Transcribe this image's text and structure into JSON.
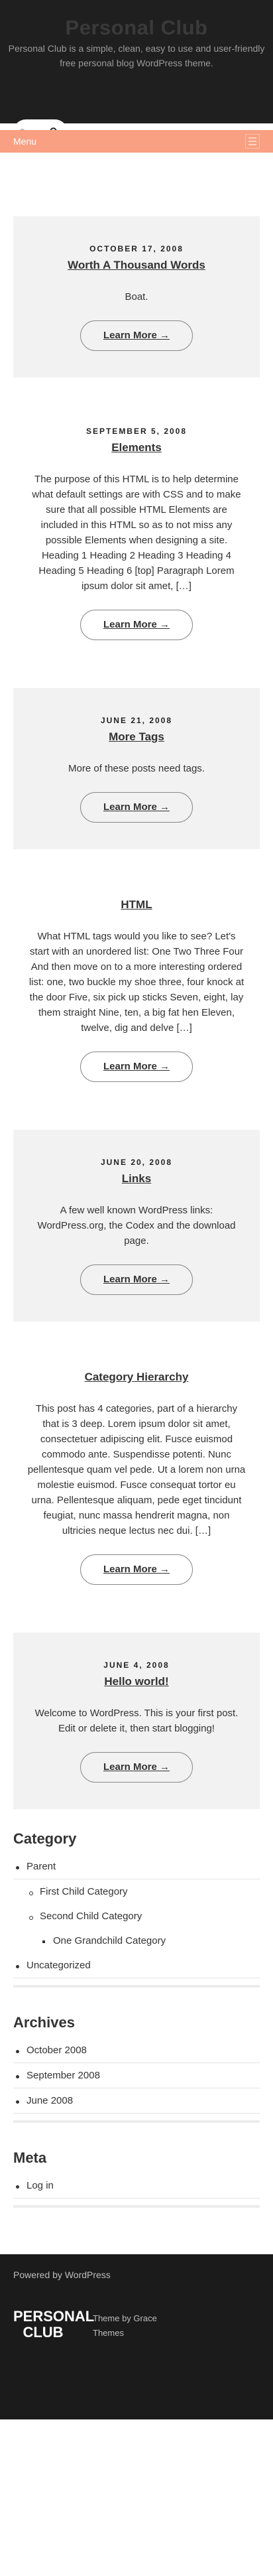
{
  "header": {
    "title": "Personal Club",
    "description": "Personal Club is a simple, clean, easy to use and user-friendly free personal blog WordPress theme."
  },
  "search": {
    "placeholder": "S",
    "icon": "search-icon"
  },
  "menu": {
    "label": "Menu",
    "toggle_icon": "hamburger-icon"
  },
  "posts": [
    {
      "date": "OCTOBER 17, 2008",
      "title": "Worth A Thousand Words",
      "excerpt": "Boat.",
      "more": "Learn More →"
    },
    {
      "date": "SEPTEMBER 5, 2008",
      "title": "Elements",
      "excerpt": "The purpose of this HTML is to help determine what default settings are with CSS and to make sure that all possible HTML Elements are included in this HTML so as to not miss any possible Elements when designing a site. Heading 1 Heading 2 Heading 3 Heading 4 Heading 5 Heading 6 [top] Paragraph Lorem ipsum dolor sit amet, […]",
      "more": "Learn More →"
    },
    {
      "date": "JUNE 21, 2008",
      "title": "More Tags",
      "excerpt": "More of these posts need tags.",
      "more": "Learn More →"
    },
    {
      "date": "",
      "title": "HTML",
      "excerpt": "What HTML tags would you like to see? Let's start with an unordered list: One Two Three Four And then move on to a more interesting ordered list: one, two buckle my shoe three, four knock at the door Five, six pick up sticks Seven, eight, lay them straight Nine, ten, a big fat hen Eleven, twelve, dig and delve […]",
      "more": "Learn More →"
    },
    {
      "date": "JUNE 20, 2008",
      "title": "Links",
      "excerpt": "A few well known WordPress links: WordPress.org, the Codex and the download page.",
      "more": "Learn More →"
    },
    {
      "date": "",
      "title": "Category Hierarchy",
      "excerpt": "This post has 4 categories, part of a hierarchy that is 3 deep. Lorem ipsum dolor sit amet, consectetuer adipiscing elit. Fusce euismod commodo ante. Suspendisse potenti. Nunc pellentesque quam vel pede. Ut a lorem non urna molestie euismod. Fusce consequat tortor eu urna. Pellentesque aliquam, pede eget tincidunt feugiat, nunc massa hendrerit magna, non ultricies neque lectus nec dui. […]",
      "more": "Learn More →"
    },
    {
      "date": "JUNE 4, 2008",
      "title": "Hello world!",
      "excerpt": "Welcome to WordPress. This is your first post. Edit or delete it, then start blogging!",
      "more": "Learn More →"
    }
  ],
  "widgets": {
    "category": {
      "title": "Category",
      "parent": "Parent",
      "first_child": "First Child Category",
      "second_child": "Second Child Category",
      "grandchild": "One Grandchild Category",
      "uncategorized": "Uncategorized"
    },
    "archives": {
      "title": "Archives",
      "items": [
        "October 2008",
        "September 2008",
        "June 2008"
      ]
    },
    "meta": {
      "title": "Meta",
      "items": [
        "Log in"
      ]
    }
  },
  "footer": {
    "powered": "Powered by WordPress",
    "logo": "PERSONAL CLUB",
    "theme_credit": "Theme by Grace Themes"
  }
}
